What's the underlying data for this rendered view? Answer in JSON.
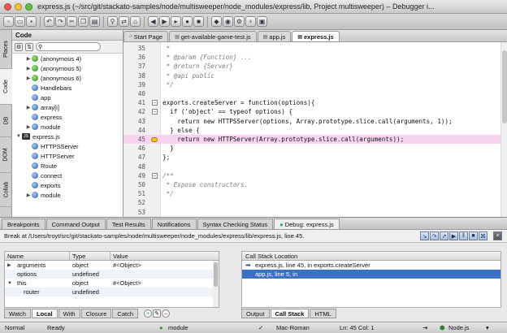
{
  "window": {
    "title": "express.js (~/src/git/stackato-samples/node/multisweeper/node_modules/express/lib, Project multisweeper) – Debugger i...",
    "colors": {
      "close": "#f05b4f",
      "minimize": "#f5c03a",
      "zoom": "#5fc23e",
      "accent": "#3c6fc6",
      "highlight": "#f8d4f0"
    }
  },
  "toolbar": {
    "icons": [
      "new-icon",
      "open-icon",
      "save-icon",
      "undo-icon",
      "redo-icon",
      "cut-icon",
      "copy-icon",
      "paste-icon",
      "find-icon",
      "replace-icon",
      "home-icon",
      "back-icon",
      "forward-icon",
      "run-icon",
      "debug-icon",
      "stop-icon",
      "macro-icon",
      "record-icon",
      "settings-icon",
      "python-icon",
      "toggle-icon"
    ]
  },
  "side_tabs": [
    "Places",
    "Code",
    "DB",
    "DOM",
    "Collab"
  ],
  "left_panel": {
    "title": "Code",
    "tree": [
      {
        "label": "(anonymous 4)",
        "indent": 1,
        "expanded": false,
        "icon": "green"
      },
      {
        "label": "(anonymous 5)",
        "indent": 1,
        "expanded": false,
        "icon": "green"
      },
      {
        "label": "(anonymous 6)",
        "indent": 1,
        "expanded": false,
        "icon": "green"
      },
      {
        "label": "Handlebars",
        "indent": 1,
        "expanded": null,
        "icon": "blue"
      },
      {
        "label": "app",
        "indent": 1,
        "expanded": null,
        "icon": "blue"
      },
      {
        "label": "array[i]",
        "indent": 1,
        "expanded": false,
        "icon": "blue"
      },
      {
        "label": "express",
        "indent": 1,
        "expanded": null,
        "icon": "blue"
      },
      {
        "label": "module",
        "indent": 1,
        "expanded": false,
        "icon": "blue"
      },
      {
        "label": "express.js",
        "indent": 0,
        "expanded": true,
        "icon": "js"
      },
      {
        "label": "HTTPSServer",
        "indent": 1,
        "expanded": null,
        "icon": "blue"
      },
      {
        "label": "HTTPServer",
        "indent": 1,
        "expanded": null,
        "icon": "blue"
      },
      {
        "label": "Route",
        "indent": 1,
        "expanded": null,
        "icon": "blue"
      },
      {
        "label": "connect",
        "indent": 1,
        "expanded": null,
        "icon": "blue"
      },
      {
        "label": "exports",
        "indent": 1,
        "expanded": null,
        "icon": "blue"
      },
      {
        "label": "module",
        "indent": 1,
        "expanded": false,
        "icon": "blue"
      }
    ]
  },
  "editor": {
    "tabs": [
      {
        "label": "Start Page",
        "active": false
      },
      {
        "label": "get-available-game-test.js",
        "active": false
      },
      {
        "label": "app.js",
        "active": false
      },
      {
        "label": "express.js",
        "active": true
      }
    ],
    "lines": [
      {
        "n": "35",
        "text": " *",
        "type": "cmt",
        "fold": false,
        "bp": false,
        "hl": false
      },
      {
        "n": "36",
        "text": " * @param {Function} ...",
        "type": "cmt",
        "fold": false,
        "bp": false,
        "hl": false
      },
      {
        "n": "37",
        "text": " * @return {Server}",
        "type": "cmt",
        "fold": false,
        "bp": false,
        "hl": false
      },
      {
        "n": "38",
        "text": " * @api public",
        "type": "cmt",
        "fold": false,
        "bp": false,
        "hl": false
      },
      {
        "n": "39",
        "text": " */",
        "type": "cmt",
        "fold": false,
        "bp": false,
        "hl": false
      },
      {
        "n": "40",
        "text": "",
        "type": "code",
        "fold": false,
        "bp": false,
        "hl": false
      },
      {
        "n": "41",
        "text": "exports.createServer = function(options){",
        "type": "code",
        "fold": true,
        "bp": false,
        "hl": false
      },
      {
        "n": "42",
        "text": "  if ('object' == typeof options) {",
        "type": "code",
        "fold": true,
        "bp": false,
        "hl": false
      },
      {
        "n": "43",
        "text": "    return new HTTPSServer(options, Array.prototype.slice.call(arguments, 1));",
        "type": "code",
        "fold": false,
        "bp": false,
        "hl": false
      },
      {
        "n": "44",
        "text": "  } else {",
        "type": "code",
        "fold": false,
        "bp": false,
        "hl": false
      },
      {
        "n": "45",
        "text": "    return new HTTPServer(Array.prototype.slice.call(arguments));",
        "type": "code",
        "fold": false,
        "bp": true,
        "hl": true
      },
      {
        "n": "46",
        "text": "  }",
        "type": "code",
        "fold": false,
        "bp": false,
        "hl": false
      },
      {
        "n": "47",
        "text": "};",
        "type": "code",
        "fold": false,
        "bp": false,
        "hl": false
      },
      {
        "n": "48",
        "text": "",
        "type": "code",
        "fold": false,
        "bp": false,
        "hl": false
      },
      {
        "n": "49",
        "text": "/**",
        "type": "cmt",
        "fold": true,
        "bp": false,
        "hl": false
      },
      {
        "n": "50",
        "text": " * Expose constructors.",
        "type": "cmt",
        "fold": false,
        "bp": false,
        "hl": false
      },
      {
        "n": "51",
        "text": " */",
        "type": "cmt",
        "fold": false,
        "bp": false,
        "hl": false
      },
      {
        "n": "52",
        "text": "",
        "type": "code",
        "fold": false,
        "bp": false,
        "hl": false
      },
      {
        "n": "53",
        "text": "",
        "type": "code",
        "fold": false,
        "bp": false,
        "hl": false
      }
    ]
  },
  "bottom_panel": {
    "tabs": [
      {
        "label": "Breakpoints",
        "active": false
      },
      {
        "label": "Command Output",
        "active": false
      },
      {
        "label": "Test Results",
        "active": false
      },
      {
        "label": "Notifications",
        "active": false
      },
      {
        "label": "Syntax Checking Status",
        "active": false
      },
      {
        "label": "Debug: express.js",
        "active": true
      }
    ],
    "break_text": "Break at /Users/troyt/src/git/stackato-samples/node/multisweeper/node_modules/express/lib/express.js, line 45.",
    "variables": {
      "headers": [
        "Name",
        "Type",
        "Value"
      ],
      "rows": [
        {
          "name": "arguments",
          "type": "object",
          "value": "#<Object>",
          "exp": "right"
        },
        {
          "name": "options",
          "type": "undefined",
          "value": "",
          "exp": ""
        },
        {
          "name": "this",
          "type": "object",
          "value": "#<Object>",
          "exp": "down"
        },
        {
          "name": "router",
          "type": "undefined",
          "value": "",
          "exp": ""
        }
      ]
    },
    "var_tabs": [
      {
        "label": "Watch",
        "active": false
      },
      {
        "label": "Local",
        "active": true
      },
      {
        "label": "With",
        "active": false
      },
      {
        "label": "Closure",
        "active": false
      },
      {
        "label": "Catch",
        "active": false
      }
    ],
    "call_stack": {
      "header": "Call Stack Location",
      "rows": [
        {
          "label": "express.js, line 45, in exports.createServer",
          "selected": false
        },
        {
          "label": "app.js, line 5, in",
          "selected": true
        }
      ]
    },
    "stack_tabs": [
      {
        "label": "Output",
        "active": false
      },
      {
        "label": "Call Stack",
        "active": true
      },
      {
        "label": "HTML",
        "active": false
      }
    ]
  },
  "statusbar": {
    "mode": "Normal",
    "state": "Ready",
    "symbol": "module",
    "encoding": "Mac-Roman",
    "position": "Ln: 45 Col: 1",
    "language": "Node.js"
  }
}
